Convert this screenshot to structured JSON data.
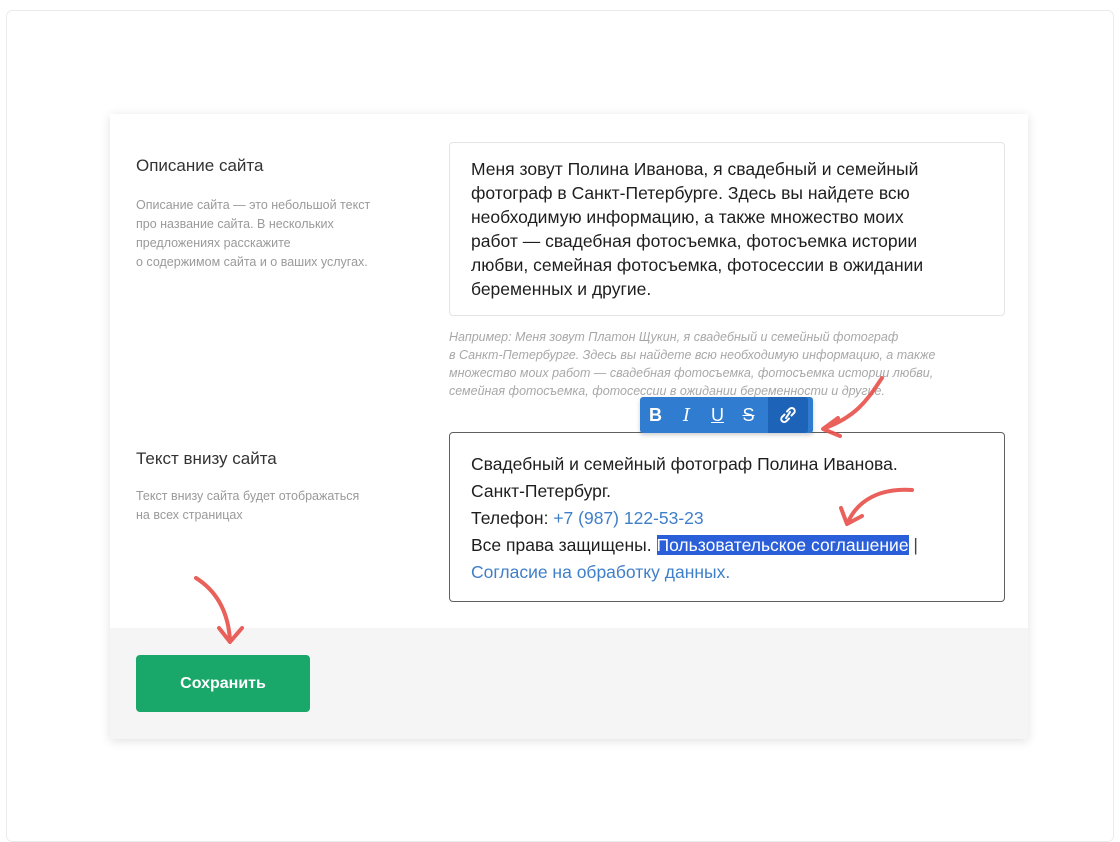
{
  "description_section": {
    "title": "Описание сайта",
    "hint_lines": [
      "Описание сайта — это небольшой текст",
      "про название сайта. В нескольких",
      "предложениях расскажите",
      "о содержимом сайта и о ваших услугах."
    ],
    "value_lines": [
      "Меня зовут Полина Иванова, я свадебный и семейный",
      "фотограф в Санкт-Петербурге. Здесь вы найдете всю",
      "необходимую информацию, а также множество моих",
      "работ — свадебная фотосъемка, фотосъемка истории",
      "любви, семейная фотосъемка, фотосессии в ожидании",
      "беременных и другие."
    ],
    "example_lines": [
      "Например: Меня зовут Платон Щукин, я свадебный и семейный фотограф",
      "в Санкт-Петербурге. Здесь вы найдете всю необходимую информацию, а также",
      "множество моих работ — свадебная фотосъемка, фотосъемка истории любви,",
      "семейная фотосъемка, фотосессии в ожидании беременности и другие."
    ]
  },
  "footer_section": {
    "title": "Текст внизу сайта",
    "hint_lines": [
      "Текст внизу сайта будет отображаться",
      "на всех страницах"
    ],
    "line1": "Свадебный и семейный фотограф Полина Иванова.",
    "line2": "Санкт-Петербург.",
    "phone_label": "Телефон: ",
    "phone_value": "+7 (987) 122-53-23",
    "rights_text": "Все права защищены. ",
    "agreement_link": "Пользовательское соглашение",
    "separator": " |",
    "consent_link": "Согласие на обработку данных."
  },
  "toolbar": {
    "bold": "B",
    "italic": "I",
    "underline": "U",
    "strikethrough": "S",
    "link_icon": "link-icon"
  },
  "save_button": {
    "label": "Сохранить"
  },
  "colors": {
    "toolbar_bg": "#2f7cd0",
    "link": "#3f7fc9",
    "selection": "#2b5fd9",
    "save_button": "#1aa76a",
    "annotation_arrow": "#e8504a"
  }
}
